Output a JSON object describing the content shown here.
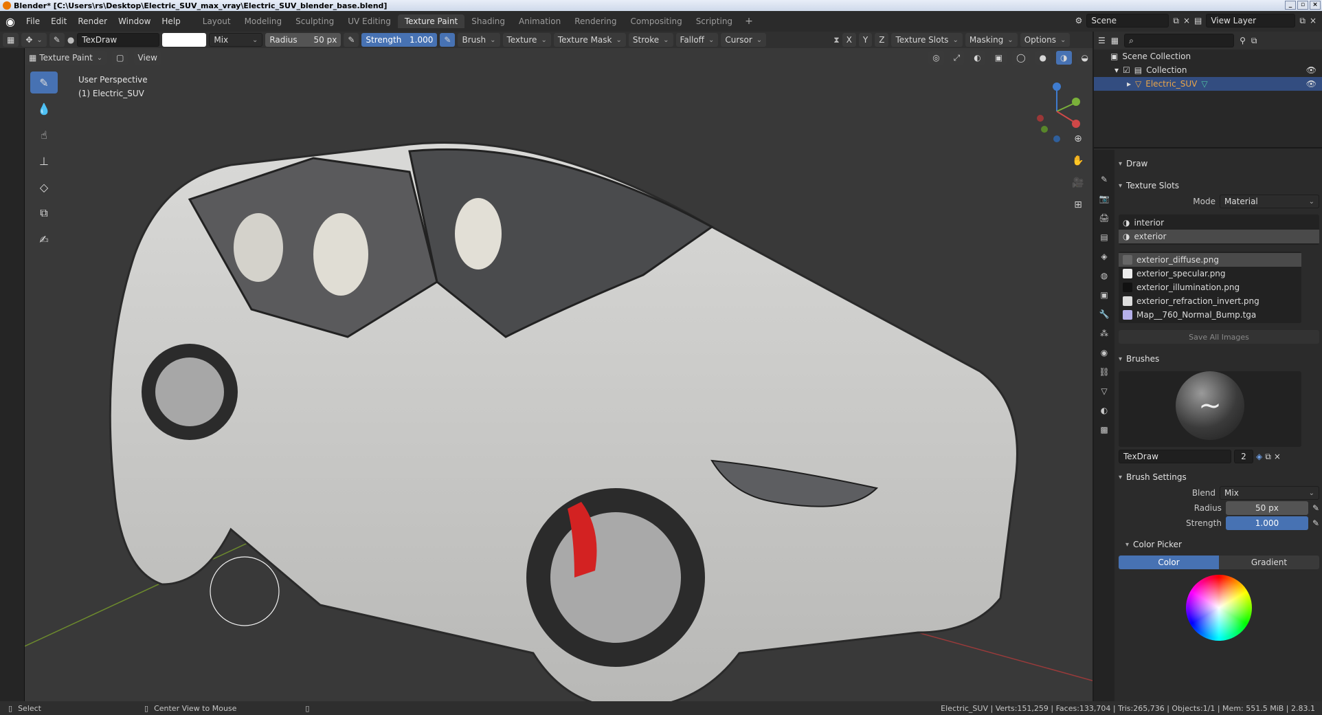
{
  "window": {
    "title": "Blender* [C:\\Users\\rs\\Desktop\\Electric_SUV_max_vray\\Electric_SUV_blender_base.blend]"
  },
  "menu": {
    "items": [
      "File",
      "Edit",
      "Render",
      "Window",
      "Help"
    ]
  },
  "workspaces": {
    "tabs": [
      "Layout",
      "Modeling",
      "Sculpting",
      "UV Editing",
      "Texture Paint",
      "Shading",
      "Animation",
      "Rendering",
      "Compositing",
      "Scripting"
    ],
    "active": "Texture Paint"
  },
  "scene": {
    "name": "Scene",
    "view_layer": "View Layer"
  },
  "tool_header": {
    "brush_name": "TexDraw",
    "blend": "Mix",
    "radius_label": "Radius",
    "radius_value": "50 px",
    "strength_label": "Strength",
    "strength_value": "1.000",
    "menus": [
      "Brush",
      "Texture",
      "Texture Mask",
      "Stroke",
      "Falloff",
      "Cursor"
    ],
    "axes": [
      "X",
      "Y",
      "Z"
    ],
    "right_menus": [
      "Texture Slots",
      "Masking",
      "Options"
    ]
  },
  "viewport_header": {
    "mode": "Texture Paint",
    "view": "View"
  },
  "viewport": {
    "perspective": "User Perspective",
    "object": "(1) Electric_SUV"
  },
  "outliner": {
    "root": "Scene Collection",
    "collection": "Collection",
    "object": "Electric_SUV"
  },
  "properties": {
    "tool_name": "Draw",
    "texture_slots": {
      "title": "Texture Slots",
      "mode_label": "Mode",
      "mode_value": "Material",
      "materials": [
        "interior",
        "exterior"
      ],
      "images": [
        "exterior_diffuse.png",
        "exterior_specular.png",
        "exterior_illumination.png",
        "exterior_refraction_invert.png",
        "Map__760_Normal_Bump.tga"
      ],
      "save_all": "Save All Images"
    },
    "brushes": {
      "title": "Brushes",
      "name": "TexDraw",
      "users": "2"
    },
    "brush_settings": {
      "title": "Brush Settings",
      "blend_label": "Blend",
      "blend_value": "Mix",
      "radius_label": "Radius",
      "radius_value": "50 px",
      "strength_label": "Strength",
      "strength_value": "1.000",
      "color_picker": "Color Picker",
      "color_tab": "Color",
      "gradient_tab": "Gradient"
    }
  },
  "status": {
    "select": "Select",
    "center": "Center View to Mouse",
    "stats": "Electric_SUV | Verts:151,259 | Faces:133,704 | Tris:265,736 | Objects:1/1 | Mem: 551.5 MiB | 2.83.1"
  },
  "colors": {
    "accent": "#4772b3",
    "selection": "#334d80",
    "viewport_bg": "#393939"
  }
}
